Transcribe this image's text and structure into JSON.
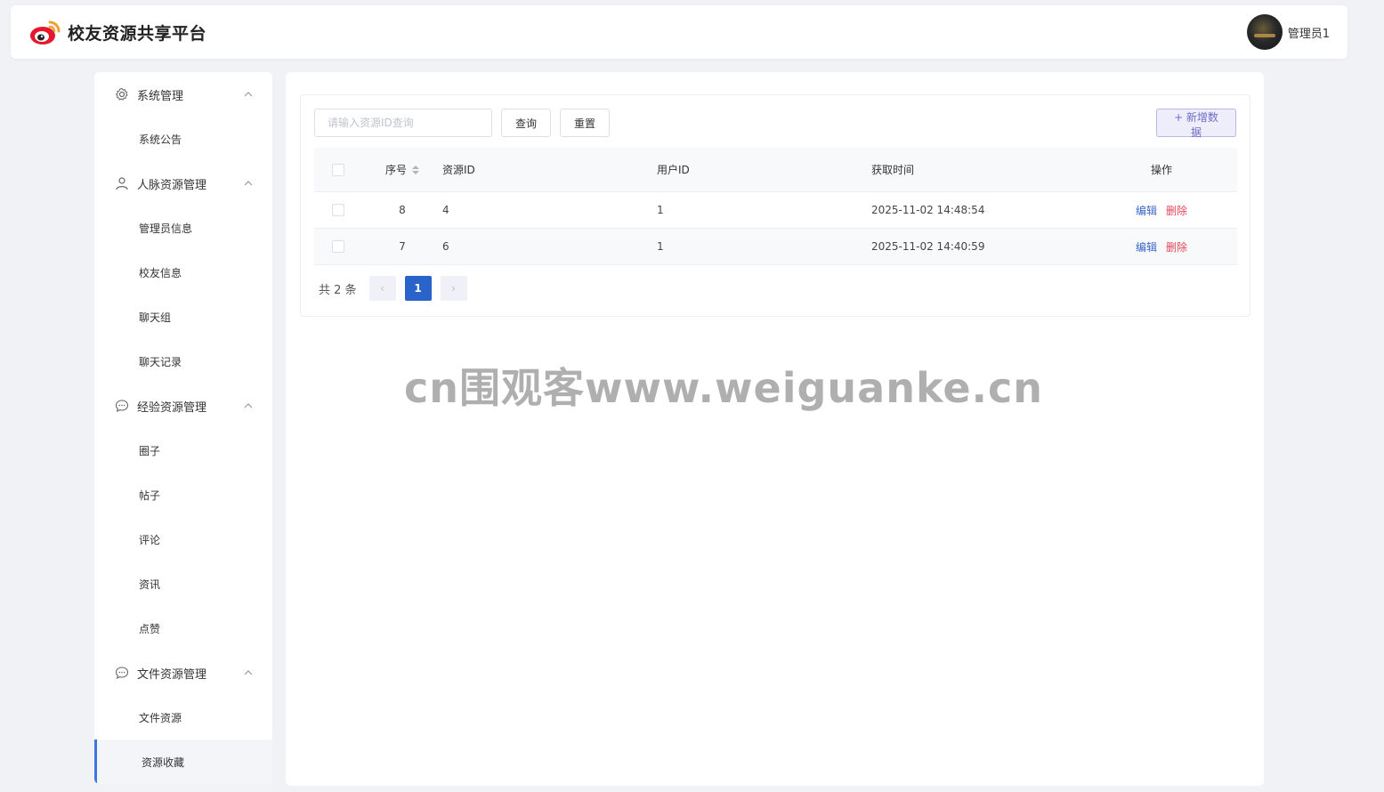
{
  "header": {
    "app_title": "校友资源共享平台",
    "user_name": "管理员1"
  },
  "sidebar": {
    "groups": [
      {
        "label": "系统管理",
        "icon": "gear-icon",
        "items": [
          "系统公告"
        ]
      },
      {
        "label": "人脉资源管理",
        "icon": "user-icon",
        "items": [
          "管理员信息",
          "校友信息",
          "聊天组",
          "聊天记录"
        ]
      },
      {
        "label": "经验资源管理",
        "icon": "chat-bubble-icon",
        "items": [
          "圈子",
          "帖子",
          "评论",
          "资讯",
          "点赞"
        ]
      },
      {
        "label": "文件资源管理",
        "icon": "chat-bubble-icon",
        "items": [
          "文件资源",
          "资源收藏"
        ]
      }
    ],
    "active_item": "资源收藏"
  },
  "toolbar": {
    "search_placeholder": "请输入资源ID查询",
    "search_value": "",
    "query_label": "查询",
    "reset_label": "重置",
    "add_label": "+ 新增数据"
  },
  "table": {
    "columns": [
      "序号",
      "资源ID",
      "用户ID",
      "获取时间",
      "操作"
    ],
    "rows": [
      {
        "idx": "8",
        "resource_id": "4",
        "user_id": "1",
        "time": "2025-11-02 14:48:54"
      },
      {
        "idx": "7",
        "resource_id": "6",
        "user_id": "1",
        "time": "2025-11-02 14:40:59"
      }
    ],
    "edit_label": "编辑",
    "delete_label": "删除"
  },
  "pagination": {
    "total_text": "共 2 条",
    "current_page": "1",
    "prev_symbol": "‹",
    "next_symbol": "›"
  },
  "watermark": "cn围观客www.weiguanke.cn",
  "colors": {
    "primary": "#2a63c9",
    "edit_link": "#3a66c8",
    "delete_link": "#e0475a",
    "logo_red": "#e6162d",
    "logo_orange": "#f0a030"
  }
}
